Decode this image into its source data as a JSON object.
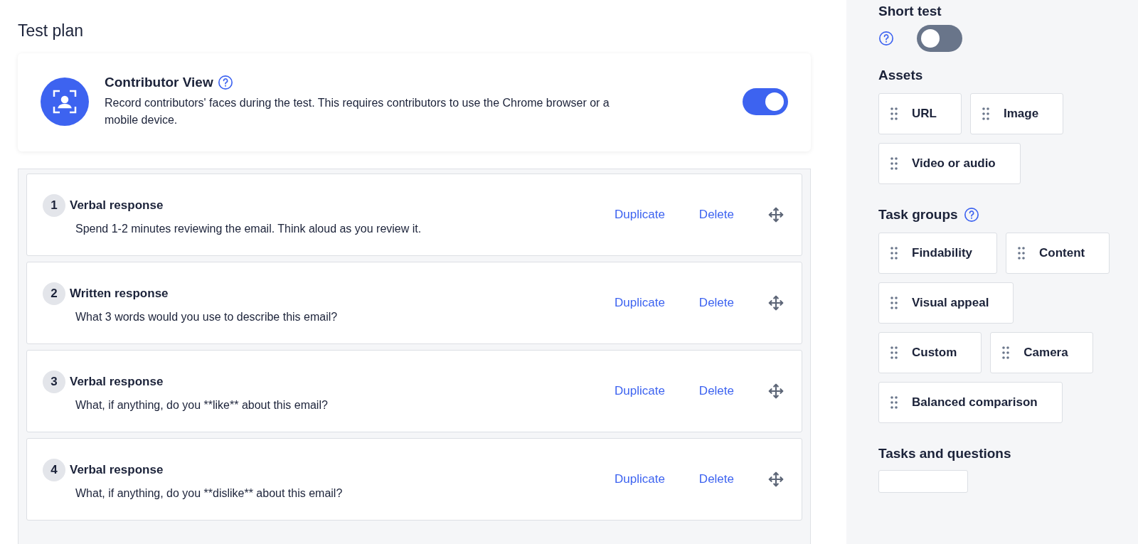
{
  "main": {
    "title": "Test plan",
    "contributor_view": {
      "title": "Contributor View",
      "description": "Record contributors' faces during the test. This requires contributors to use the Chrome browser or a mobile device.",
      "on": true
    },
    "steps": [
      {
        "number": "1",
        "title": "Verbal response",
        "description": "Spend 1-2 minutes reviewing the email. Think aloud as you review it.",
        "actions": [
          "Duplicate",
          "Delete"
        ]
      },
      {
        "number": "2",
        "title": "Written response",
        "description": "What 3 words would you use to describe this email?",
        "actions": [
          "Duplicate",
          "Delete"
        ]
      },
      {
        "number": "3",
        "title": "Verbal response",
        "description": "What, if anything, do you **like** about this email?",
        "actions": [
          "Duplicate",
          "Delete"
        ]
      },
      {
        "number": "4",
        "title": "Verbal response",
        "description": "What, if anything, do you **dislike** about this email?",
        "actions": [
          "Duplicate",
          "Delete"
        ]
      }
    ]
  },
  "sidebar": {
    "short_test": {
      "label": "Short test",
      "on": false
    },
    "sections": [
      {
        "title": "Assets",
        "help": false,
        "items": [
          "URL",
          "Image",
          "Video or audio"
        ]
      },
      {
        "title": "Task groups",
        "help": true,
        "items": [
          "Findability",
          "Content",
          "Visual appeal",
          "Custom",
          "Camera",
          "Balanced comparison"
        ]
      },
      {
        "title": "Tasks and questions",
        "help": false
      }
    ]
  }
}
